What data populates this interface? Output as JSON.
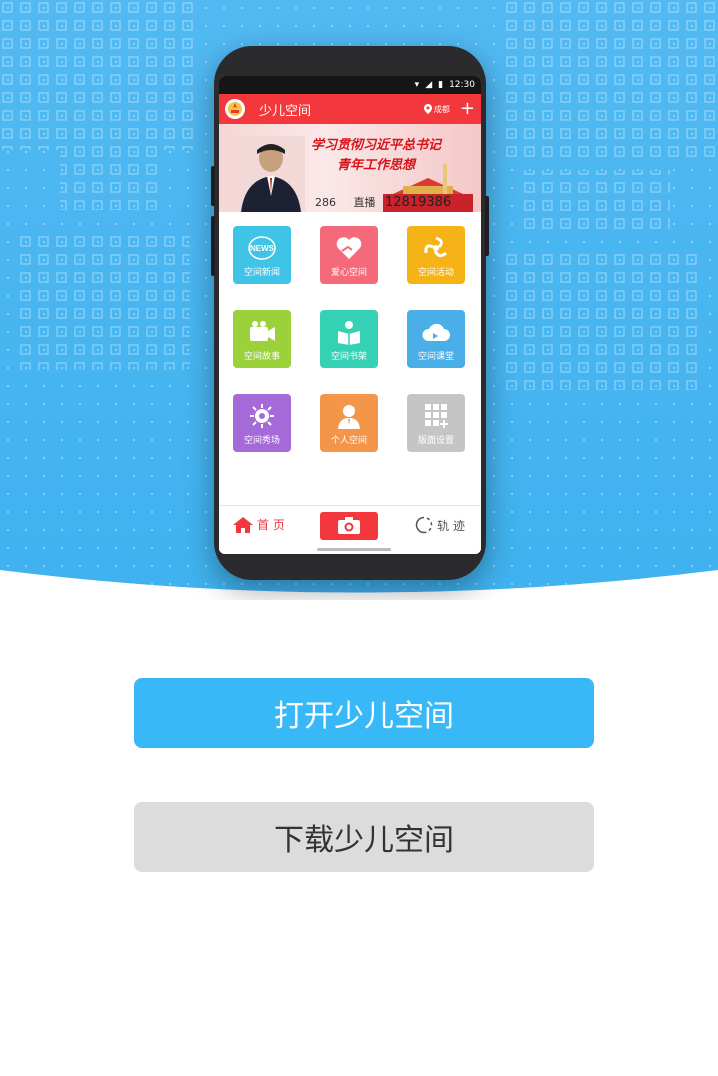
{
  "phone": {
    "status_time": "12:30",
    "app_title": "少儿空间",
    "location": "成都",
    "add_label": "+",
    "banner": {
      "slogan_line1": "学习贯彻习近平总书记",
      "slogan_line2": "青年工作思想",
      "ticker_prefix": "286",
      "ticker_label": "直播",
      "ticker_number": "12819386"
    },
    "tiles": [
      {
        "label": "空间新闻",
        "color": "#3fc3e6",
        "icon": "news-icon"
      },
      {
        "label": "爱心空间",
        "color": "#f46a7a",
        "icon": "heart-hand-icon"
      },
      {
        "label": "空间活动",
        "color": "#f6b318",
        "icon": "activity-swirl-icon"
      },
      {
        "label": "空间故事",
        "color": "#9bd23c",
        "icon": "video-camera-icon"
      },
      {
        "label": "空间书架",
        "color": "#35d1b5",
        "icon": "book-reader-icon"
      },
      {
        "label": "空间课堂",
        "color": "#4aaee8",
        "icon": "cloud-classroom-icon"
      },
      {
        "label": "空间秀场",
        "color": "#a56ad8",
        "icon": "show-star-icon"
      },
      {
        "label": "个人空间",
        "color": "#f3964a",
        "icon": "person-icon"
      },
      {
        "label": "版面设置",
        "color": "#c5c5c5",
        "icon": "grid-settings-icon"
      }
    ],
    "tabbar": {
      "home": "首 页",
      "track": "轨 迹"
    }
  },
  "buttons": {
    "open": "打开少儿空间",
    "download": "下载少儿空间"
  },
  "colors": {
    "hero_blue": "#3fb2ef",
    "app_red": "#f2383c",
    "open_button": "#38b8f6",
    "download_button": "#dcdcdc"
  }
}
